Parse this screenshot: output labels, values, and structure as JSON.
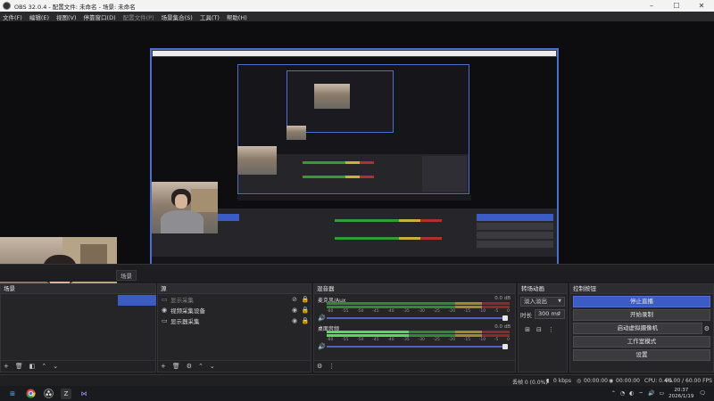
{
  "titlebar": {
    "title": "OBS 32.0.4 - 配置文件: 未命名 - 场景: 未命名",
    "minimize": "–",
    "maximize": "☐",
    "close": "✕"
  },
  "menu": [
    "文件(F)",
    "编辑(E)",
    "视图(V)",
    "停靠窗口(D)",
    "配置文件(P)",
    "场景集合(S)",
    "工具(T)",
    "帮助(H)"
  ],
  "tabs": {
    "scenes_tab": "场景",
    "transitions_tab": "转场"
  },
  "docks": {
    "scenes": {
      "title": "场景",
      "selected": ""
    },
    "sources": {
      "title": "源",
      "items": [
        {
          "name": "显示采集",
          "icon": "monitor-icon"
        },
        {
          "name": "视频采集设备",
          "icon": "camera-icon"
        },
        {
          "name": "显示器采集",
          "icon": "monitor-icon"
        }
      ]
    },
    "mixer": {
      "title": "混音器",
      "channels": [
        {
          "name": "麦克风/Aux",
          "db": "0.0 dB",
          "level": 0.62
        },
        {
          "name": "桌面音频",
          "db": "0.0 dB",
          "level": 0.45
        }
      ],
      "scale": [
        "-60",
        "-55",
        "-50",
        "-45",
        "-40",
        "-35",
        "-30",
        "-25",
        "-20",
        "-15",
        "-10",
        "-5",
        "0"
      ]
    },
    "transitions": {
      "title": "转场动画",
      "type": "淡入淡出",
      "duration_label": "时长",
      "duration": "300 ms"
    },
    "controls": {
      "title": "控制按钮",
      "buttons": [
        "停止直播",
        "开始录制",
        "启动虚拟摄像机",
        "工作室模式",
        "设置"
      ]
    }
  },
  "status": {
    "drops": "丢帧 0 (0.0%)",
    "bitrate": "0 kbps",
    "rec_time": "00:00:00",
    "stream_time": "00:00:00",
    "cpu": "CPU: 0.4%",
    "fps": "60.00 / 60.00 FPS"
  },
  "taskbar": {
    "time": "20:37",
    "date": "2026/1/19"
  },
  "colors": {
    "accent": "#3b5cc4",
    "preview_border": "#4a6fd0",
    "meter_green": "#59d85a",
    "meter_yellow": "#a08a2e",
    "meter_red": "#8a2a2a"
  }
}
